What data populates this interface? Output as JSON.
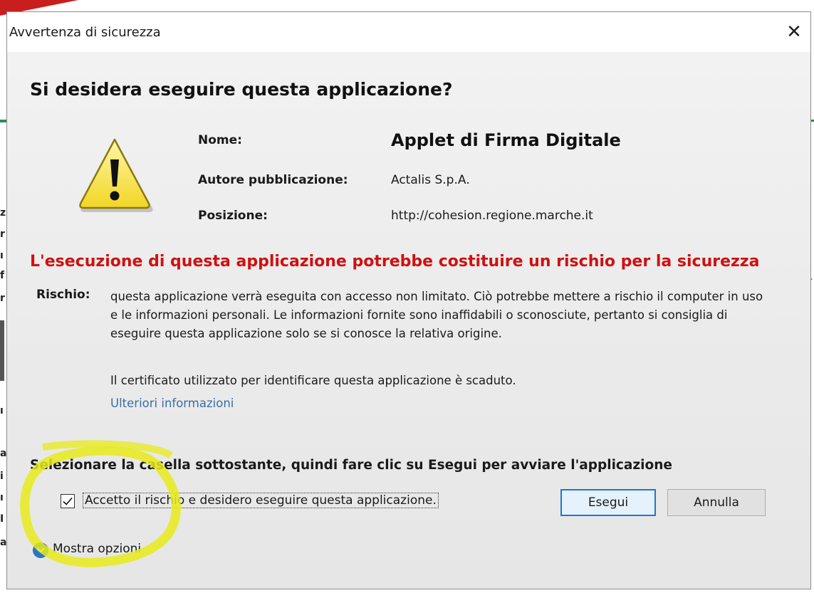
{
  "dialog": {
    "title": "Avvertenza di sicurezza",
    "close_glyph": "✕",
    "heading": "Si desidera eseguire questa applicazione?"
  },
  "app_info": {
    "name_label": "Nome:",
    "name_value": "Applet di Firma Digitale",
    "publisher_label": "Autore pubblicazione:",
    "publisher_value": "Actalis S.p.A.",
    "location_label": "Posizione:",
    "location_value": "http://cohesion.regione.marche.it"
  },
  "warning": {
    "title": "L'esecuzione di questa applicazione potrebbe costituire un rischio per la sicurezza",
    "risk_label": "Rischio:",
    "risk_text": "questa applicazione verrà eseguita con accesso non limitato. Ciò potrebbe mettere a rischio il computer in uso e le informazioni personali. Le informazioni fornite sono inaffidabili o sconosciute, pertanto si consiglia di eseguire questa applicazione solo se si conosce la relativa origine.",
    "certificate_text": "Il certificato utilizzato per identificare questa applicazione è scaduto.",
    "more_info_link": "Ulteriori informazioni"
  },
  "footer": {
    "instruction": "Selezionare la casella sottostante, quindi fare clic su Esegui per avviare l'applicazione",
    "accept_checkbox_label": "Accetto il rischio e desidero eseguire questa applicazione.",
    "accept_checked": true,
    "run_button": "Esegui",
    "cancel_button": "Annulla",
    "show_options": "Mostra opzioni"
  },
  "colors": {
    "warning_red": "#d01010",
    "link_blue": "#3a6ea5",
    "highlight_yellow": "#e8ea1a",
    "primary_button_border": "#1f77d0"
  },
  "icons": {
    "warning": "warning-triangle-icon",
    "close": "close-icon",
    "checkbox": "checkmark-icon",
    "options": "chevron-down-icon"
  }
}
